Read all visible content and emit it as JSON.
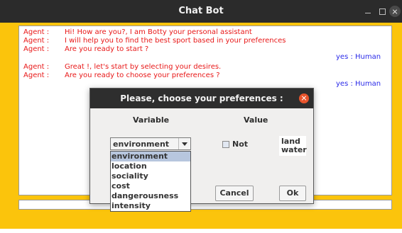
{
  "window": {
    "title": "Chat Bot"
  },
  "chat": {
    "messages": [
      {
        "speaker": "Agent :",
        "text": "Hi! How are you?, I am Botty your personal assistant"
      },
      {
        "speaker": "Agent :",
        "text": "I will help you to find the best sport based in your preferences"
      },
      {
        "speaker": "Agent :",
        "text": "Are you ready to start ?"
      },
      {
        "speaker": "Agent :",
        "text": "Great !, let's start by selecting your desires."
      },
      {
        "speaker": "Agent :",
        "text": "Are you ready to choose your preferences ?"
      }
    ],
    "replies": [
      {
        "text": "yes   : Human"
      },
      {
        "text": "yes   : Human"
      }
    ]
  },
  "dialog": {
    "title": "Please, choose your preferences :",
    "col_variable": "Variable",
    "col_value": "Value",
    "variable_selected": "environment",
    "variable_options": [
      "environment",
      "location",
      "sociality",
      "cost",
      "dangerousness",
      "intensity"
    ],
    "not_label": "Not",
    "not_checked": false,
    "value_options": [
      "land",
      "water"
    ],
    "cancel_label": "Cancel",
    "ok_label": "Ok"
  },
  "colors": {
    "background": "#fbc40c",
    "agent_text": "#e81818",
    "human_text": "#2a2ae8",
    "selection": "#b7c6de",
    "dialog_close": "#e9542c"
  }
}
